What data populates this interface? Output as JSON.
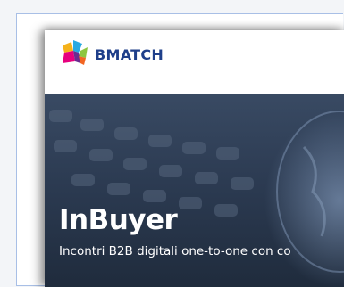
{
  "brand": {
    "name": "BMATCH",
    "logo_icon": "colorful-puzzle-star-icon",
    "accent": "#1f3f8a"
  },
  "hero": {
    "title": "InBuyer",
    "subtitle": "Incontri B2B digitali one-to-one con co"
  }
}
